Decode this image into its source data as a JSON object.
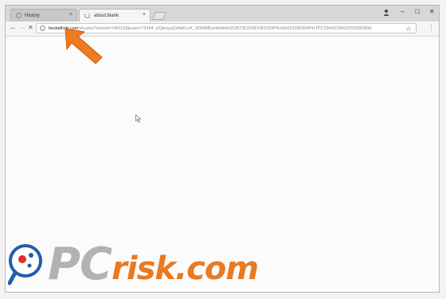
{
  "browser": {
    "tabs": [
      {
        "label": "History"
      },
      {
        "label": "about:blank"
      }
    ],
    "window_controls": {
      "minimize": "–",
      "maximize": "☐",
      "close": "✕"
    },
    "toolbar": {
      "back": "←",
      "forward": "→",
      "stop": "✕",
      "url_domain": "bestadlinkl.com",
      "url_rest": "/xfu.php?zoneid=1450153&varn=72494_UQkmyaQzifsELxX_XDBtBBymWdmhUS26T3C000DVB1003PN166H102BO6WPHTPC19H412650Z6V028O800",
      "star_icon": "star-icon"
    }
  },
  "watermark": {
    "part1": "PC",
    "part2": "risk.com"
  },
  "colors": {
    "arrow": "#f07a1e",
    "logo_blue": "#1f5ea8",
    "logo_red": "#d9332b"
  }
}
